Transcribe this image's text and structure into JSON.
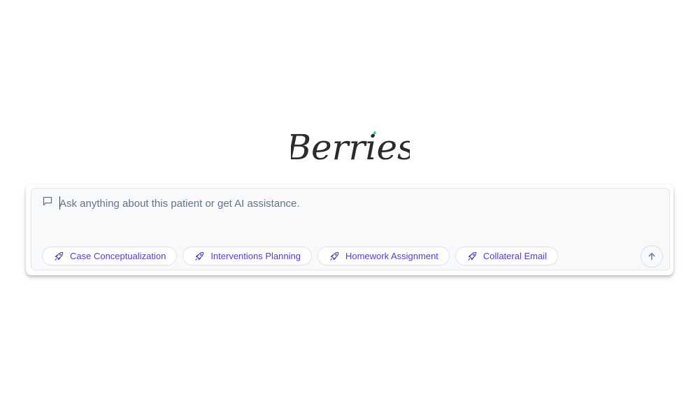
{
  "brand": {
    "logo_text": "Berries",
    "logo_color": "#2b2b2b",
    "accent_dot_color": "#4ec9a0"
  },
  "composer": {
    "icon": "message-square-icon",
    "placeholder": "Ask anything about this patient or get AI assistance.",
    "value": ""
  },
  "chips": [
    {
      "label": "Case Conceptualization",
      "icon": "rocket-icon"
    },
    {
      "label": "Interventions Planning",
      "icon": "rocket-icon"
    },
    {
      "label": "Homework Assignment",
      "icon": "rocket-icon"
    },
    {
      "label": "Collateral Email",
      "icon": "rocket-icon"
    }
  ],
  "send_button": {
    "icon": "arrow-up-icon"
  },
  "colors": {
    "chip_text": "#4c3fd1",
    "placeholder_text": "#64748b",
    "composer_bg": "#f7f9fb"
  }
}
